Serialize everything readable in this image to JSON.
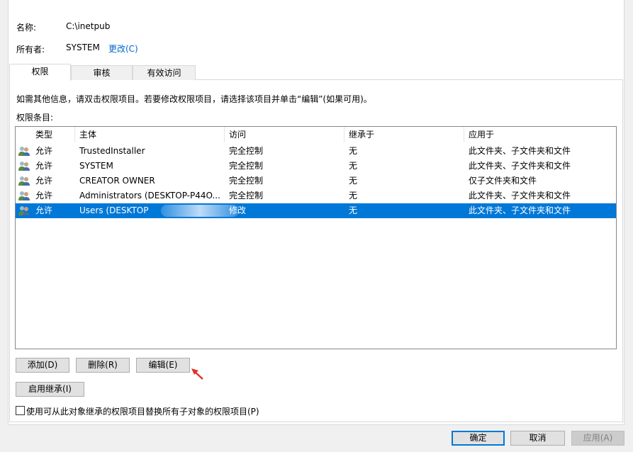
{
  "header": {
    "name_label": "名称:",
    "name_value": "C:\\inetpub",
    "owner_label": "所有者:",
    "owner_value": "SYSTEM",
    "change_link": "更改(C)"
  },
  "tabs": [
    {
      "label": "权限",
      "active": true
    },
    {
      "label": "审核",
      "active": false
    },
    {
      "label": "有效访问",
      "active": false
    }
  ],
  "permissions": {
    "info_text": "如需其他信息，请双击权限项目。若要修改权限项目，请选择该项目并单击“编辑”(如果可用)。",
    "entries_label": "权限条目:",
    "columns": [
      "类型",
      "主体",
      "访问",
      "继承于",
      "应用于"
    ],
    "rows": [
      {
        "type": "允许",
        "principal": "TrustedInstaller",
        "access": "完全控制",
        "inherited": "无",
        "applies": "此文件夹、子文件夹和文件",
        "selected": false
      },
      {
        "type": "允许",
        "principal": "SYSTEM",
        "access": "完全控制",
        "inherited": "无",
        "applies": "此文件夹、子文件夹和文件",
        "selected": false
      },
      {
        "type": "允许",
        "principal": "CREATOR OWNER",
        "access": "完全控制",
        "inherited": "无",
        "applies": "仅子文件夹和文件",
        "selected": false
      },
      {
        "type": "允许",
        "principal": "Administrators (DESKTOP-P44O...",
        "access": "完全控制",
        "inherited": "无",
        "applies": "此文件夹、子文件夹和文件",
        "selected": false
      },
      {
        "type": "允许",
        "principal": "Users (DESKTOP",
        "access": "修改",
        "inherited": "无",
        "applies": "此文件夹、子文件夹和文件",
        "selected": true
      }
    ]
  },
  "actions": {
    "add": "添加(D)",
    "remove": "删除(R)",
    "edit": "编辑(E)",
    "enable_inheritance": "启用继承(I)",
    "replace_checkbox_label": "使用可从此对象继承的权限项目替换所有子对象的权限项目(P)"
  },
  "dialog_buttons": {
    "ok": "确定",
    "cancel": "取消",
    "apply": "应用(A)"
  },
  "colors": {
    "selection": "#0078d7",
    "link": "#0066cc",
    "arrow": "#e0322c"
  }
}
